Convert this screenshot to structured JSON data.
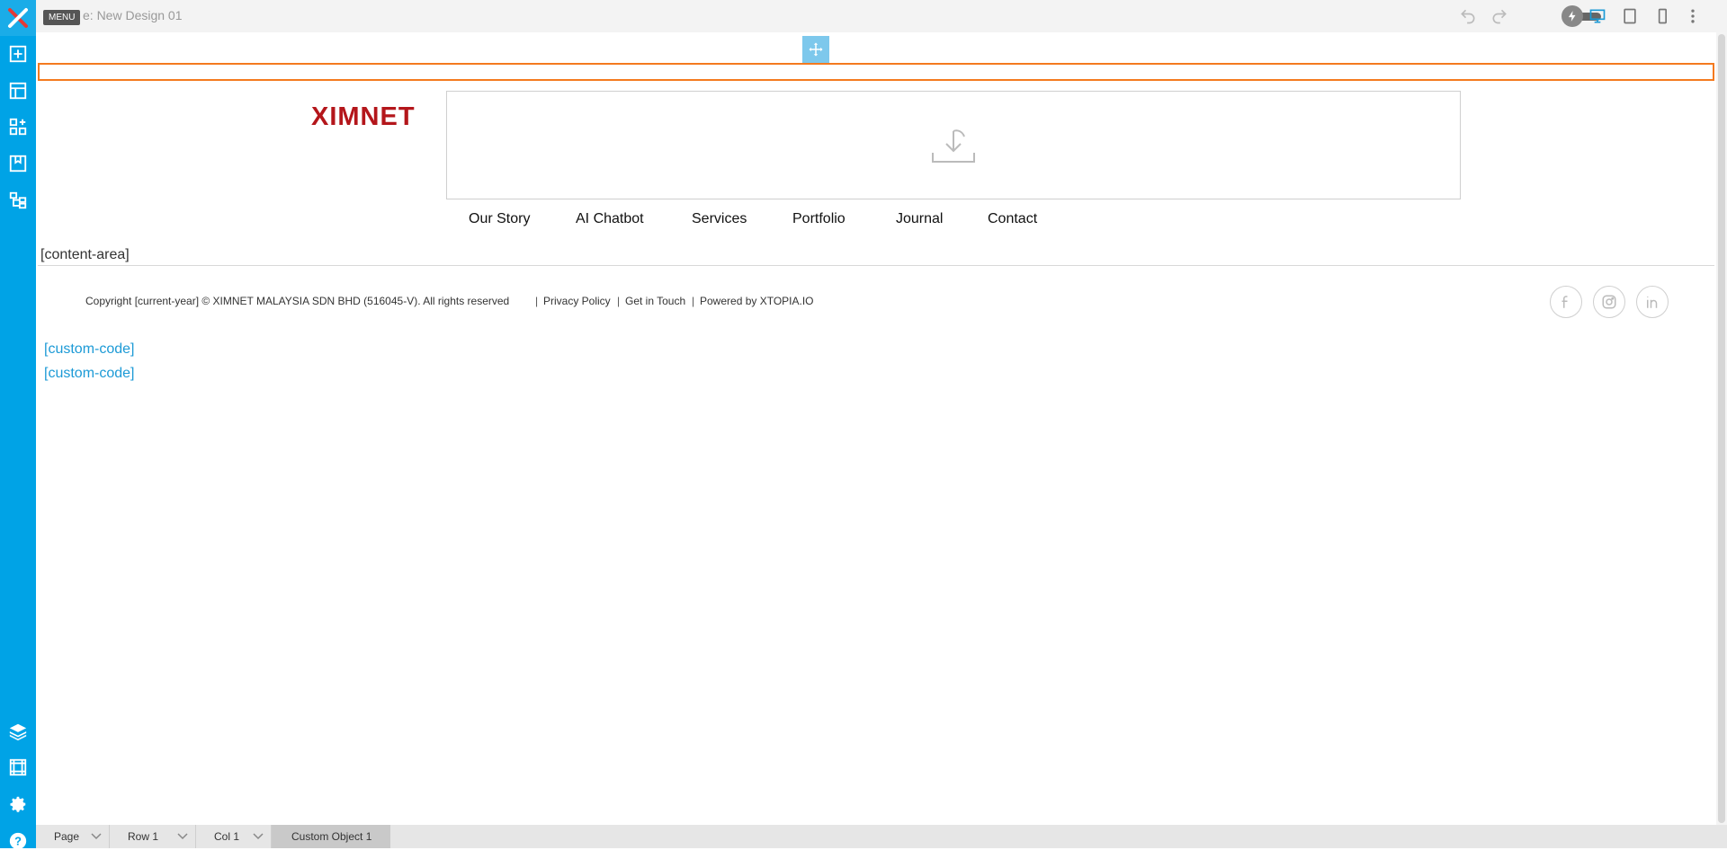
{
  "topbar": {
    "menu_tooltip": "MENU",
    "page_title": "e: New Design 01",
    "icons": [
      "undo-icon",
      "redo-icon",
      "lightning-toggle",
      "desktop-icon",
      "tablet-icon",
      "mobile-icon",
      "more-icon"
    ]
  },
  "sidebar": {
    "top_icons": [
      "add-icon",
      "layout-icon",
      "widgets-icon",
      "bookmark-icon",
      "sitemap-icon"
    ],
    "bottom_icons": [
      "layers-icon",
      "media-icon",
      "gear-icon",
      "help-icon"
    ]
  },
  "header": {
    "logo_text": "XIMNET",
    "nav": [
      "Our Story",
      "AI Chatbot",
      "Services",
      "Portfolio",
      "Journal",
      "Contact"
    ]
  },
  "content": {
    "placeholder": "[content-area]"
  },
  "footer": {
    "copyright": "Copyright [current-year] © XIMNET MALAYSIA SDN BHD (516045-V).  All rights reserved",
    "privacy": "Privacy Policy",
    "touch": "Get in Touch",
    "powered": "Powered by XTOPIA.IO",
    "sep": "|",
    "social": [
      "facebook-icon",
      "instagram-icon",
      "linkedin-icon"
    ]
  },
  "custom_code": [
    "[custom-code]",
    "[custom-code]"
  ],
  "breadcrumb": [
    "Page",
    "Row 1",
    "Col 1",
    "Custom Object 1"
  ],
  "colors": {
    "sidebar": "#00a3e6",
    "selection": "#f47a1f",
    "logo": "#b4161b",
    "link": "#1c9ad6"
  }
}
